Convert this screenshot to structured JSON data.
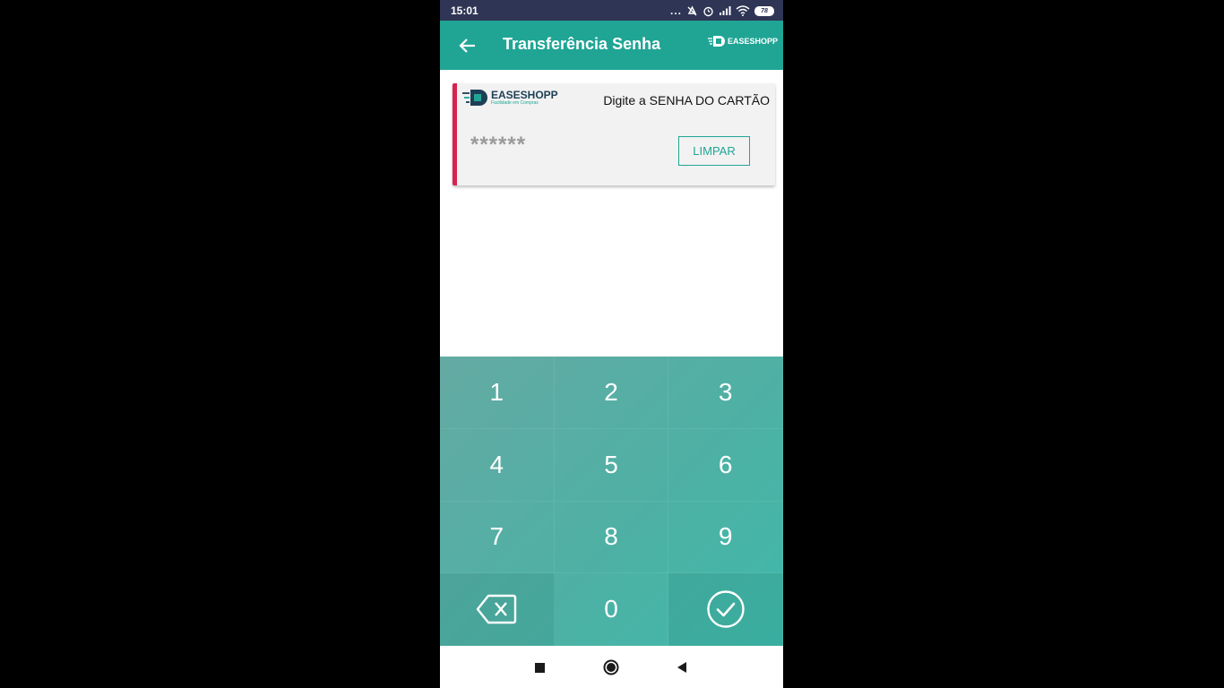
{
  "status_bar": {
    "time": "15:01",
    "dots": "...",
    "battery": "78"
  },
  "app_bar": {
    "title": "Transferência Senha",
    "logo_text": "EASESHOPP"
  },
  "card": {
    "logo_text": "EASESHOPP",
    "logo_tagline": "Facilidade em Compras",
    "instruction": "Digite a SENHA DO CARTÃO",
    "password_mask": "******",
    "clear_label": "LIMPAR"
  },
  "keypad": {
    "keys": [
      "1",
      "2",
      "3",
      "4",
      "5",
      "6",
      "7",
      "8",
      "9",
      "0"
    ],
    "backspace_icon": "backspace-icon",
    "confirm_icon": "check-circle-icon"
  },
  "nav_bar": {
    "recents_icon": "square-icon",
    "home_icon": "circle-icon",
    "back_icon": "triangle-back-icon"
  },
  "colors": {
    "status_bar": "#2e3555",
    "app_bar": "#20a595",
    "card_accent": "#d6234f",
    "keypad": "#4fb0a4"
  }
}
